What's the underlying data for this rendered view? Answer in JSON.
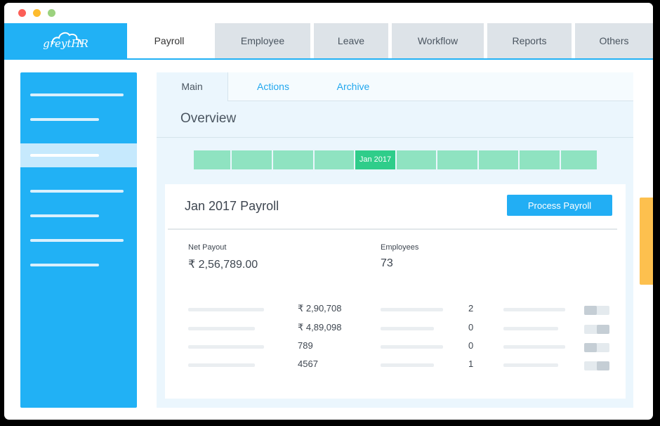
{
  "app": {
    "logo_text": "greytHR",
    "colors": {
      "accent": "#21b1f5",
      "timeline": "#8fe3c1",
      "timeline_selected": "#2fcd8a",
      "handle": "#fdc04e"
    }
  },
  "nav": {
    "tabs": [
      "Payroll",
      "Employee",
      "Leave",
      "Workflow",
      "Reports",
      "Others"
    ],
    "active": "Payroll"
  },
  "subnav": {
    "tabs": [
      "Main",
      "Actions",
      "Archive"
    ],
    "active": "Main"
  },
  "overview": {
    "title": "Overview",
    "timeline_selected": "Jan 2017"
  },
  "payroll": {
    "title": "Jan 2017 Payroll",
    "process_button": "Process Payroll",
    "net_payout_label": "Net Payout",
    "net_payout_value": "₹ 2,56,789.00",
    "employees_label": "Employees",
    "employees_value": "73",
    "rows": [
      {
        "amount": "₹ 2,90,708",
        "count": "2"
      },
      {
        "amount": "₹ 4,89,098",
        "count": "0"
      },
      {
        "amount": "789",
        "count": "0"
      },
      {
        "amount": "4567",
        "count": "1"
      }
    ]
  }
}
